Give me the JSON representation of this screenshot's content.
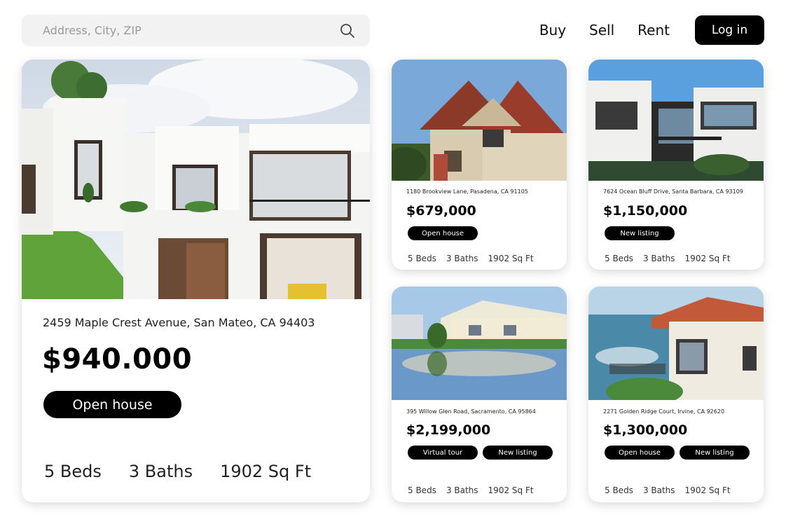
{
  "search": {
    "placeholder": "Address, City, ZIP"
  },
  "nav": {
    "buy": "Buy",
    "sell": "Sell",
    "rent": "Rent",
    "login": "Log in"
  },
  "featured": {
    "address": "2459 Maple Crest Avenue, San Mateo, CA 94403",
    "price": "$940.000",
    "tag": "Open house",
    "beds": "5 Beds",
    "baths": "3 Baths",
    "sqft": "1902 Sq Ft"
  },
  "listings": [
    {
      "address": "1180 Brookview Lane, Pasadena, CA 91105",
      "price": "$679,000",
      "tags": [
        "Open house"
      ],
      "beds": "5 Beds",
      "baths": "3 Baths",
      "sqft": "1902 Sq Ft"
    },
    {
      "address": "7624 Ocean Bluff Drive, Santa Barbara, CA 93109",
      "price": "$1,150,000",
      "tags": [
        "New listing"
      ],
      "beds": "5 Beds",
      "baths": "3 Baths",
      "sqft": "1902 Sq Ft"
    },
    {
      "address": "395 Willow Glen Road, Sacramento, CA 95864",
      "price": "$2,199,000",
      "tags": [
        "Virtual tour",
        "New listing"
      ],
      "beds": "5 Beds",
      "baths": "3 Baths",
      "sqft": "1902 Sq Ft"
    },
    {
      "address": "2271 Golden Ridge Court, Irvine, CA 92620",
      "price": "$1,300,000",
      "tags": [
        "Open house",
        "New listing"
      ],
      "beds": "5 Beds",
      "baths": "3 Baths",
      "sqft": "1902 Sq Ft"
    }
  ],
  "icons": {
    "search": "search-icon"
  },
  "colors": {
    "button_bg": "#000000",
    "search_bg": "#f2f2f2",
    "page_bg": "#ffffff"
  }
}
